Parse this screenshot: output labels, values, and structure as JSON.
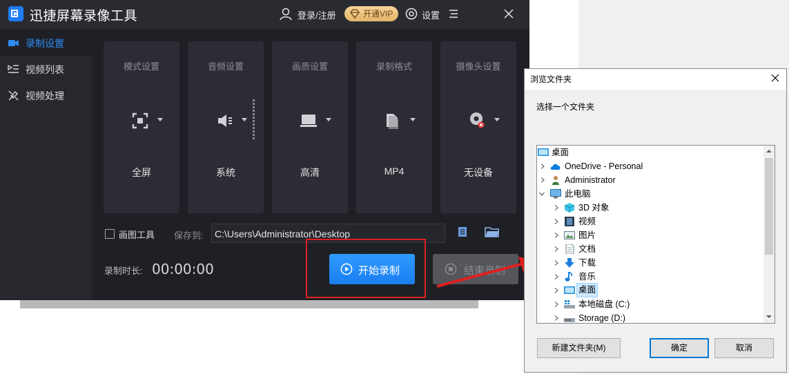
{
  "app": {
    "title": "迅捷屏幕录像工具",
    "login_label": "登录/注册",
    "vip_label": "开通VIP",
    "settings_label": "设置"
  },
  "sidebar": {
    "items": [
      {
        "label": "录制设置",
        "icon": "video-camera-icon",
        "active": true
      },
      {
        "label": "视频列表",
        "icon": "video-list-icon",
        "active": false
      },
      {
        "label": "视频处理",
        "icon": "tools-icon",
        "active": false
      }
    ]
  },
  "cards": [
    {
      "title": "模式设置",
      "value": "全屏",
      "icon": "fullscreen-icon"
    },
    {
      "title": "音频设置",
      "value": "系统",
      "icon": "speaker-icon"
    },
    {
      "title": "画质设置",
      "value": "高清",
      "icon": "monitor-icon"
    },
    {
      "title": "录制格式",
      "value": "MP4",
      "icon": "file-icon"
    },
    {
      "title": "摄像头设置",
      "value": "无设备",
      "icon": "webcam-disabled-icon"
    }
  ],
  "options": {
    "draw_tool_label": "画图工具",
    "draw_tool_checked": false,
    "save_to_label": "保存到:",
    "save_path": "C:\\Users\\Administrator\\Desktop"
  },
  "recording": {
    "duration_label": "录制时长:",
    "duration_value": "00:00:00",
    "start_label": "开始录制",
    "stop_label": "结束录制"
  },
  "colors": {
    "accent": "#2d8cf0",
    "highlight": "#e02020",
    "vip_gold": "#e3b468"
  },
  "dialog": {
    "title": "浏览文件夹",
    "description": "选择一个文件夹",
    "tree": [
      {
        "label": "桌面",
        "icon": "desktop-icon",
        "level": 0,
        "expander": "none"
      },
      {
        "label": "OneDrive - Personal",
        "icon": "cloud-icon",
        "level": 1,
        "expander": "collapsed"
      },
      {
        "label": "Administrator",
        "icon": "user-folder-icon",
        "level": 1,
        "expander": "collapsed"
      },
      {
        "label": "此电脑",
        "icon": "computer-icon",
        "level": 1,
        "expander": "expanded"
      },
      {
        "label": "3D 对象",
        "icon": "3d-objects-icon",
        "level": 2,
        "expander": "collapsed"
      },
      {
        "label": "视频",
        "icon": "videos-folder-icon",
        "level": 2,
        "expander": "collapsed"
      },
      {
        "label": "图片",
        "icon": "pictures-folder-icon",
        "level": 2,
        "expander": "collapsed"
      },
      {
        "label": "文档",
        "icon": "documents-folder-icon",
        "level": 2,
        "expander": "collapsed"
      },
      {
        "label": "下载",
        "icon": "downloads-folder-icon",
        "level": 2,
        "expander": "collapsed"
      },
      {
        "label": "音乐",
        "icon": "music-folder-icon",
        "level": 2,
        "expander": "collapsed"
      },
      {
        "label": "桌面",
        "icon": "desktop-icon",
        "level": 2,
        "expander": "collapsed",
        "selected": true
      },
      {
        "label": "本地磁盘 (C:)",
        "icon": "drive-icon",
        "level": 2,
        "expander": "collapsed"
      },
      {
        "label": "Storage (D:)",
        "icon": "drive-icon",
        "level": 2,
        "expander": "collapsed"
      }
    ],
    "new_folder_label": "新建文件夹(M)",
    "ok_label": "确定",
    "cancel_label": "取消"
  }
}
